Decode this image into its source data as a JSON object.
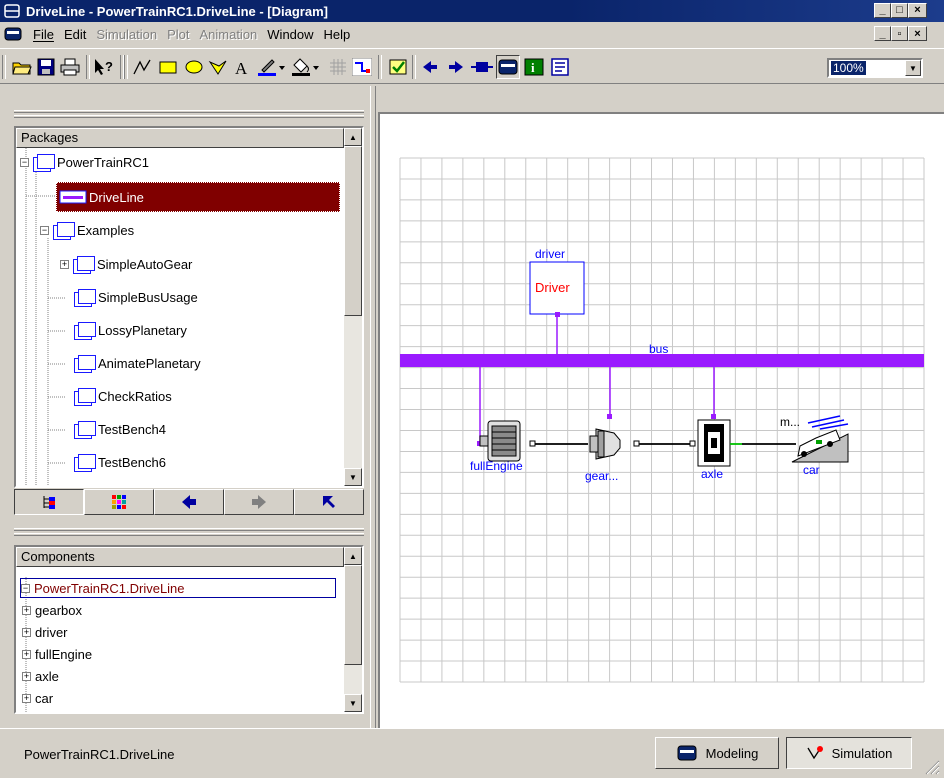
{
  "window": {
    "title": "DriveLine - PowerTrainRC1.DriveLine - [Diagram]",
    "minimize": "_",
    "maximize": "□",
    "close": "×",
    "mdi_minimize": "_",
    "mdi_restore": "▫",
    "mdi_close": "×"
  },
  "menu": [
    {
      "label": "File",
      "enabled": true
    },
    {
      "label": "Edit",
      "enabled": true
    },
    {
      "label": "Simulation",
      "enabled": false
    },
    {
      "label": "Plot",
      "enabled": false
    },
    {
      "label": "Animation",
      "enabled": false
    },
    {
      "label": "Window",
      "enabled": true
    },
    {
      "label": "Help",
      "enabled": true
    }
  ],
  "toolbar": {
    "zoom_value": "100%",
    "icons": [
      "open-folder-icon",
      "save-icon",
      "print-icon",
      "whats-this-icon",
      "line-tool-icon",
      "rectangle-tool-icon",
      "ellipse-tool-icon",
      "polygon-tool-icon",
      "text-tool-icon",
      "line-color-icon",
      "fill-color-icon",
      "grid-toggle-icon",
      "connect-mode-icon",
      "check-icon",
      "back-arrow-icon",
      "forward-arrow-icon",
      "component-icon",
      "modeling-view-icon",
      "info-view-icon",
      "documentation-view-icon"
    ]
  },
  "packages": {
    "header": "Packages",
    "items": [
      {
        "label": "PowerTrainRC1",
        "expander": "−",
        "level": 0
      },
      {
        "label": "DriveLine",
        "expander": "",
        "level": 1,
        "selected": true
      },
      {
        "label": "Examples",
        "expander": "−",
        "level": 1
      },
      {
        "label": "SimpleAutoGear",
        "expander": "+",
        "level": 2
      },
      {
        "label": "SimpleBusUsage",
        "expander": "",
        "level": 2
      },
      {
        "label": "LossyPlanetary",
        "expander": "",
        "level": 2
      },
      {
        "label": "AnimatePlanetary",
        "expander": "",
        "level": 2
      },
      {
        "label": "CheckRatios",
        "expander": "",
        "level": 2
      },
      {
        "label": "TestBench4",
        "expander": "",
        "level": 2
      },
      {
        "label": "TestBench6",
        "expander": "",
        "level": 2
      }
    ]
  },
  "components": {
    "header": "Components",
    "items": [
      {
        "label": "PowerTrainRC1.DriveLine",
        "expander": "−",
        "root": true
      },
      {
        "label": "gearbox",
        "expander": "+"
      },
      {
        "label": "driver",
        "expander": "+"
      },
      {
        "label": "fullEngine",
        "expander": "+"
      },
      {
        "label": "axle",
        "expander": "+"
      },
      {
        "label": "car",
        "expander": "+"
      }
    ]
  },
  "diagram": {
    "bus_label": "bus",
    "driver_label": "driver",
    "driver_text": "Driver",
    "engine_label": "fullEngine",
    "gear_label": "gear...",
    "axle_label": "axle",
    "car_label": "car",
    "car_top_label": "m..."
  },
  "statusbar": {
    "text": "PowerTrainRC1.DriveLine",
    "modeling_label": "Modeling",
    "simulation_label": "Simulation"
  },
  "colors": {
    "title_bg": "#0a246a",
    "selection": "#800000",
    "bus": "#9a1aff",
    "link_blue": "#0000ff",
    "driver_red": "#ff0000",
    "grid": "#c8c8c8"
  }
}
